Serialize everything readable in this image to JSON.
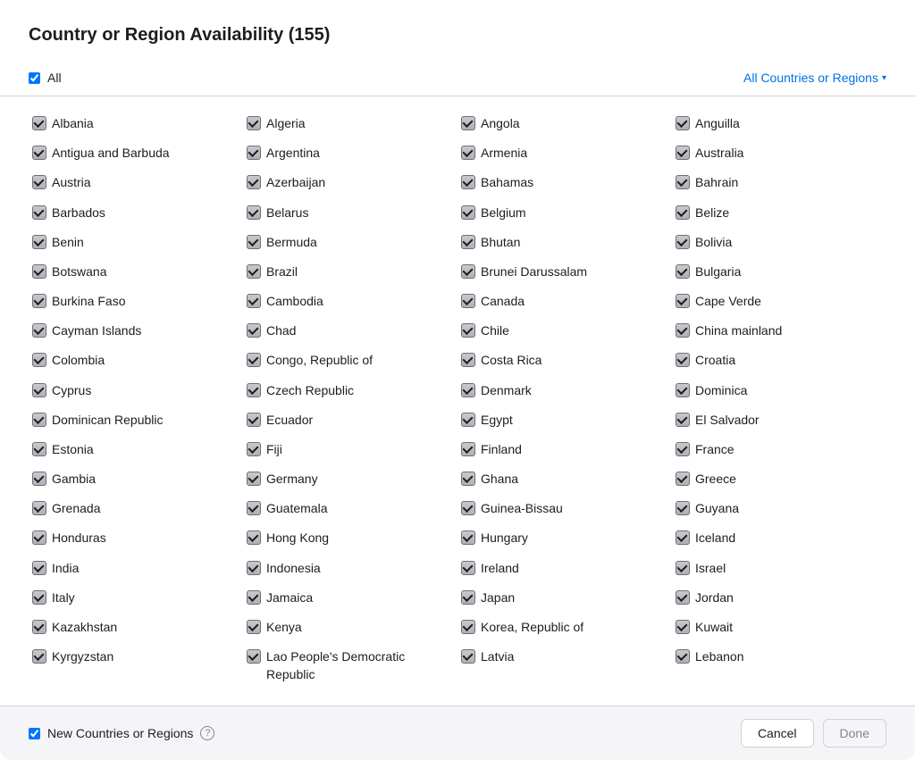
{
  "header": {
    "title": "Country or Region Availability (155)"
  },
  "filter": {
    "all_label": "All",
    "dropdown_label": "All Countries or Regions",
    "dropdown_icon": "chevron-down"
  },
  "countries": [
    "Albania",
    "Algeria",
    "Angola",
    "Anguilla",
    "Antigua and Barbuda",
    "Argentina",
    "Armenia",
    "Australia",
    "Austria",
    "Azerbaijan",
    "Bahamas",
    "Bahrain",
    "Barbados",
    "Belarus",
    "Belgium",
    "Belize",
    "Benin",
    "Bermuda",
    "Bhutan",
    "Bolivia",
    "Botswana",
    "Brazil",
    "Brunei Darussalam",
    "Bulgaria",
    "Burkina Faso",
    "Cambodia",
    "Canada",
    "Cape Verde",
    "Cayman Islands",
    "Chad",
    "Chile",
    "China mainland",
    "Colombia",
    "Congo, Republic of",
    "Costa Rica",
    "Croatia",
    "Cyprus",
    "Czech Republic",
    "Denmark",
    "Dominica",
    "Dominican Republic",
    "Ecuador",
    "Egypt",
    "El Salvador",
    "Estonia",
    "Fiji",
    "Finland",
    "France",
    "Gambia",
    "Germany",
    "Ghana",
    "Greece",
    "Grenada",
    "Guatemala",
    "Guinea-Bissau",
    "Guyana",
    "Honduras",
    "Hong Kong",
    "Hungary",
    "Iceland",
    "India",
    "Indonesia",
    "Ireland",
    "Israel",
    "Italy",
    "Jamaica",
    "Japan",
    "Jordan",
    "Kazakhstan",
    "Kenya",
    "Korea, Republic of",
    "Kuwait",
    "Kyrgyzstan",
    "Lao People's Democratic Republic",
    "Latvia",
    "Lebanon"
  ],
  "footer": {
    "new_countries_label": "New Countries or Regions",
    "cancel_label": "Cancel",
    "done_label": "Done"
  }
}
